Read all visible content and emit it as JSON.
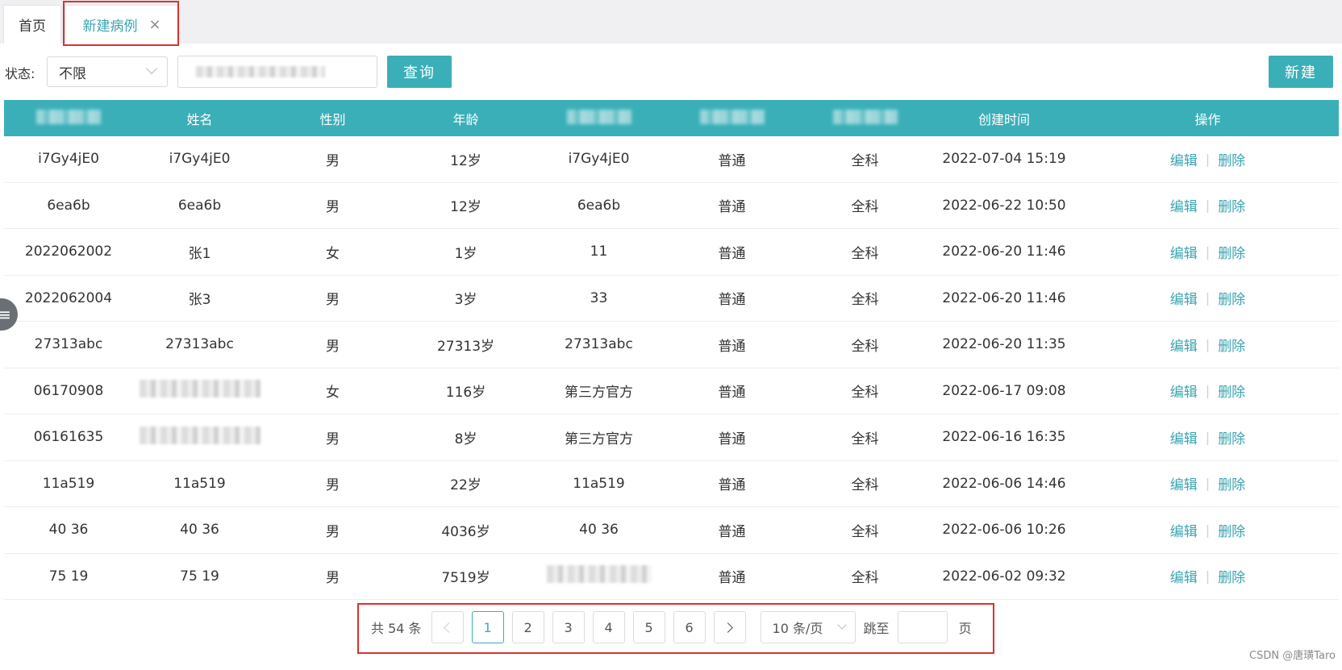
{
  "tabs": [
    {
      "label": "首页"
    },
    {
      "label": "新建病例",
      "close": "×"
    }
  ],
  "filter": {
    "status_label": "状态:",
    "status_value": "不限",
    "query_label": "查询",
    "new_label": "新建"
  },
  "table": {
    "headers": [
      "",
      "姓名",
      "性别",
      "年龄",
      "",
      "",
      "",
      "创建时间",
      "操作"
    ],
    "rows": [
      [
        "i7Gy4jE0",
        "i7Gy4jE0",
        "男",
        "12岁",
        "i7Gy4jE0",
        "普通",
        "全科",
        "2022-07-04 15:19"
      ],
      [
        "6ea6b",
        "6ea6b",
        "男",
        "12岁",
        "6ea6b",
        "普通",
        "全科",
        "2022-06-22 10:50"
      ],
      [
        "2022062002",
        "张1",
        "女",
        "1岁",
        "11",
        "普通",
        "全科",
        "2022-06-20 11:46"
      ],
      [
        "2022062004",
        "张3",
        "男",
        "3岁",
        "33",
        "普通",
        "全科",
        "2022-06-20 11:46"
      ],
      [
        "27313abc",
        "27313abc",
        "男",
        "27313岁",
        "27313abc",
        "普通",
        "全科",
        "2022-06-20 11:35"
      ],
      [
        "06170908",
        "",
        "女",
        "116岁",
        "第三方官方",
        "普通",
        "全科",
        "2022-06-17 09:08"
      ],
      [
        "06161635",
        "",
        "男",
        "8岁",
        "第三方官方",
        "普通",
        "全科",
        "2022-06-16 16:35"
      ],
      [
        "11a519",
        "11a519",
        "男",
        "22岁",
        "11a519",
        "普通",
        "全科",
        "2022-06-06 14:46"
      ],
      [
        "40 36",
        "40 36",
        "男",
        "4036岁",
        "40 36",
        "普通",
        "全科",
        "2022-06-06 10:26"
      ],
      [
        "75 19",
        "75 19",
        "男",
        "7519岁",
        "",
        "普通",
        "全科",
        "2022-06-02 09:32"
      ]
    ],
    "edit_label": "编辑",
    "delete_label": "删除",
    "separator": "|"
  },
  "pagination": {
    "total": "共 54 条",
    "pages": [
      "1",
      "2",
      "3",
      "4",
      "5",
      "6"
    ],
    "current": "1",
    "page_size": "10 条/页",
    "jump_label": "跳至",
    "page_unit": "页"
  },
  "side_handle_icon": "menu-icon",
  "watermark": "CSDN @唐璜Taro",
  "colors": {
    "accent": "#3aafb8",
    "highlight_border": "#d9312f"
  }
}
